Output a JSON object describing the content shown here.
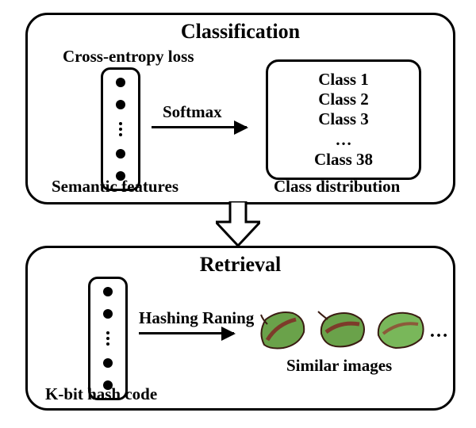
{
  "classification": {
    "title": "Classification",
    "loss_label": "Cross-entropy loss",
    "features_label": "Semantic features",
    "arrow_label": "Softmax",
    "classbox": {
      "c1": "Class 1",
      "c2": "Class 2",
      "c3": "Class 3",
      "dots": "…",
      "c38": "Class 38"
    },
    "dist_label": "Class distribution"
  },
  "retrieval": {
    "title": "Retrieval",
    "code_label": "K-bit hash code",
    "arrow_label": "Hashing Raning",
    "similar_label": "Similar images",
    "trailing": "…"
  }
}
